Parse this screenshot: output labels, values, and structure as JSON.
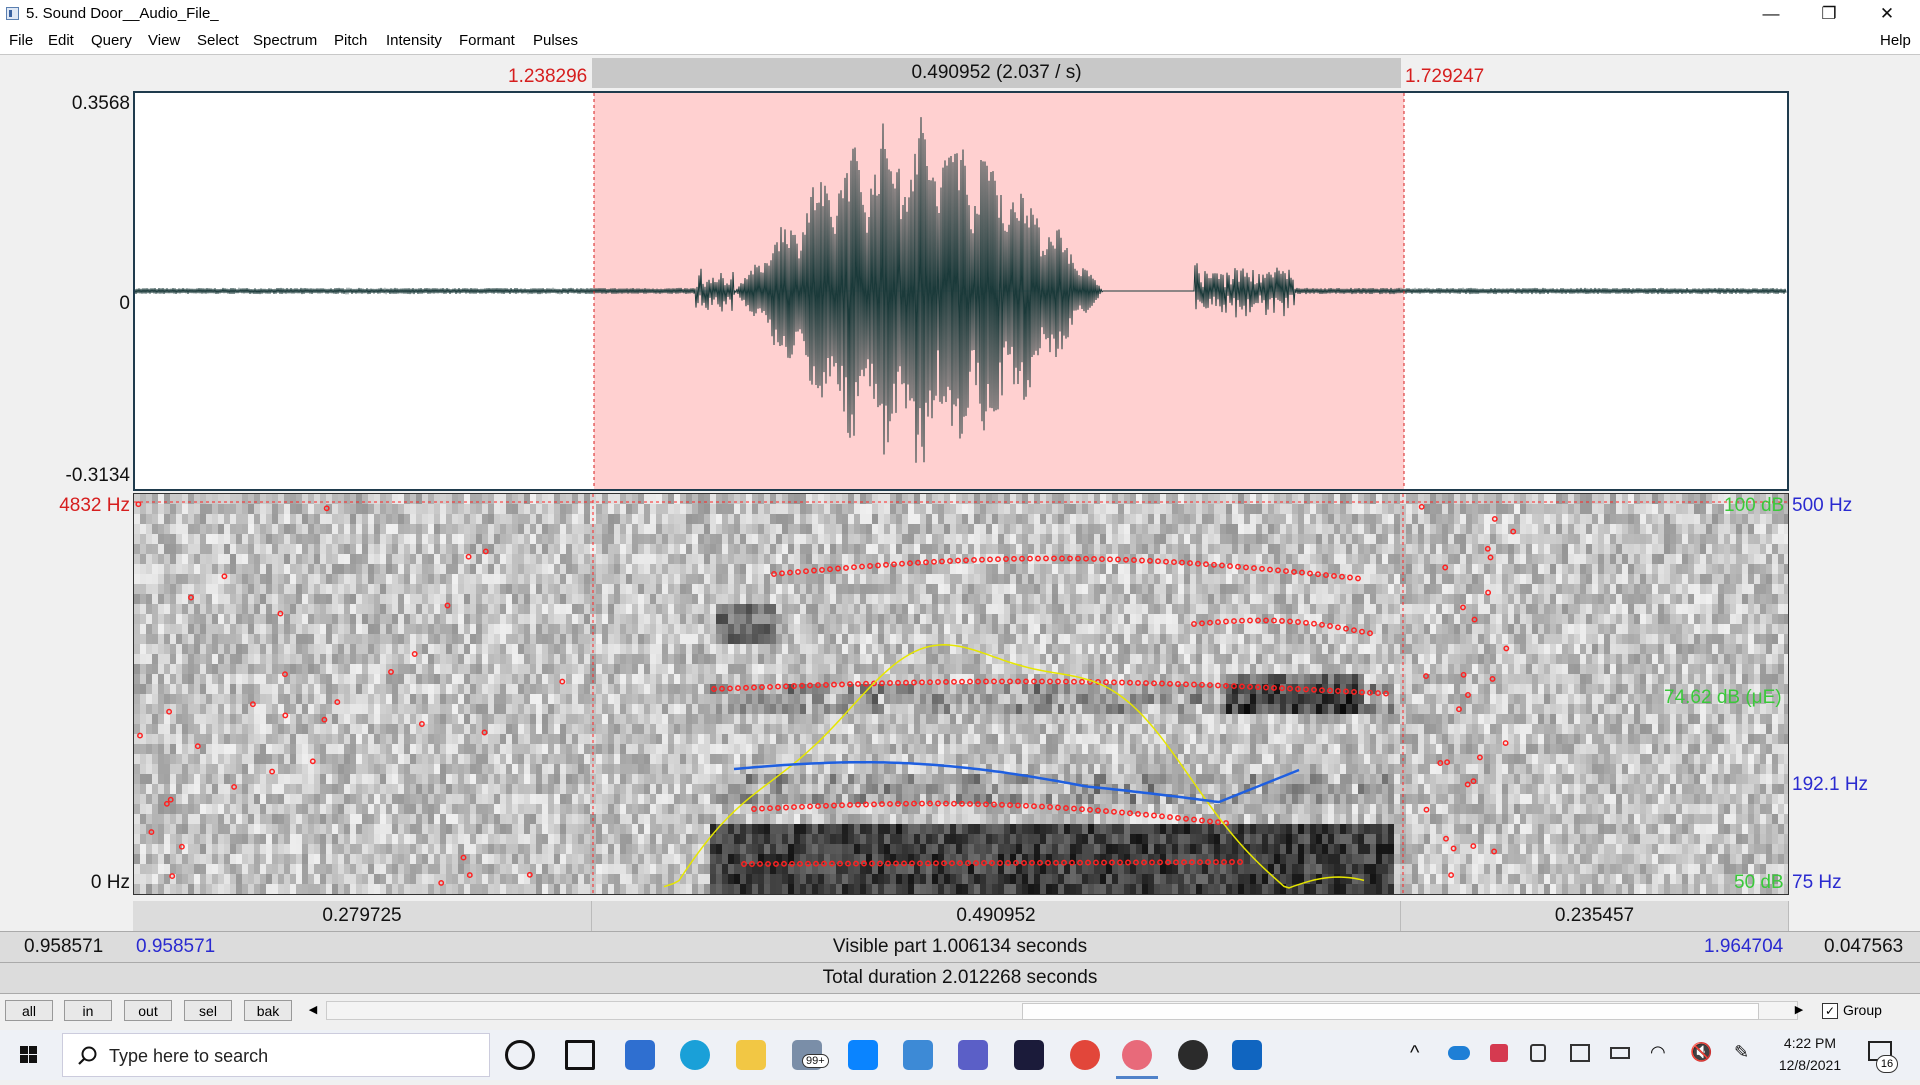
{
  "window": {
    "title": "5. Sound Door__Audio_File_",
    "minimize": "—",
    "restore": "❐",
    "close": "✕"
  },
  "menu": {
    "items": [
      "File",
      "Edit",
      "Query",
      "View",
      "Select",
      "Spectrum",
      "Pitch",
      "Intensity",
      "Formant",
      "Pulses"
    ],
    "help": "Help"
  },
  "selection": {
    "start": "1.238296",
    "end": "1.729247",
    "duration_label": "0.490952 (2.037 / s)"
  },
  "waveform": {
    "y_max": "0.3568",
    "y_zero": "0",
    "y_min": "-0.3134"
  },
  "spectrogram": {
    "freq_max": "4832 Hz",
    "freq_min": "0 Hz",
    "intensity_top": "100 dB",
    "intensity_mid": "74.62 dB (μE)",
    "intensity_bottom": "50 dB",
    "pitch_top": "500 Hz",
    "pitch_mid": "192.1 Hz",
    "pitch_bottom": "75 Hz"
  },
  "segments": {
    "left": "0.279725",
    "middle": "0.490952",
    "right": "0.235457"
  },
  "visible": {
    "outer_left": "0.958571",
    "left": "0.958571",
    "label": "Visible part 1.006134 seconds",
    "right": "1.964704",
    "outer_right": "0.047563"
  },
  "total": {
    "label": "Total duration 2.012268 seconds"
  },
  "bottom_buttons": [
    "all",
    "in",
    "out",
    "sel",
    "bak"
  ],
  "group_label": "Group",
  "group_checked": "✓",
  "taskbar": {
    "search_placeholder": "Type here to search",
    "mail_badge": "99+",
    "time": "4:22 PM",
    "date": "12/8/2021",
    "notification_count": "16",
    "apps": [
      "cortana-icon",
      "task-view-icon",
      "store-icon",
      "edge-icon",
      "file-explorer-icon",
      "mail-icon",
      "app-blue-icon",
      "remote-desktop-icon",
      "teams-icon",
      "dreamweaver-icon",
      "chrome-icon",
      "praat-icon",
      "media-player-icon",
      "outlook-icon"
    ]
  },
  "colors": {
    "selection_red": "#d61e1e",
    "selection_fill": "#ffd0d0",
    "pitch_blue": "#1f5fe0",
    "intensity_yellow": "#e6e600",
    "formant_red": "#ff2222",
    "db_green": "#3ac93a",
    "hz_blue": "#2a2ad0",
    "wave_dark": "#1b3a3a"
  }
}
